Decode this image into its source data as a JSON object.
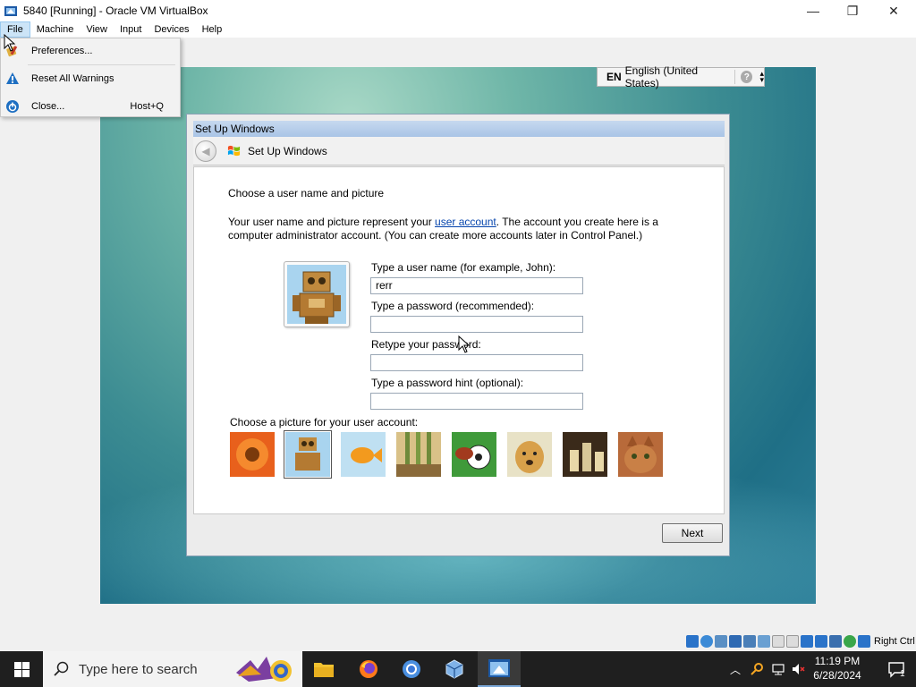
{
  "window": {
    "title": "5840 [Running] - Oracle VM VirtualBox",
    "controls": {
      "minimize": "—",
      "restore": "❐",
      "close": "✕"
    }
  },
  "menubar": {
    "items": [
      "File",
      "Machine",
      "View",
      "Input",
      "Devices",
      "Help"
    ],
    "active": "File"
  },
  "file_menu": {
    "items": [
      {
        "label": "Preferences...",
        "icon": "preferences-icon",
        "shortcut": ""
      },
      {
        "label": "Reset All Warnings",
        "icon": "warning-icon",
        "shortcut": ""
      },
      {
        "label": "Close...",
        "icon": "power-icon",
        "shortcut": "Host+Q"
      }
    ]
  },
  "langbar": {
    "code": "EN",
    "language": "English (United States)",
    "help": "?"
  },
  "setup": {
    "caption": "Set Up Windows",
    "header_title": "Set Up Windows",
    "heading": "Choose a user name and picture",
    "desc_part1": "Your user name and picture represent your ",
    "desc_link": "user account",
    "desc_part2": ". The account you create here is a computer administrator account. (You can create more accounts later in Control Panel.)",
    "fields": [
      {
        "label": "Type a user name (for example, John):",
        "value": "rerr"
      },
      {
        "label": "Type a password (recommended):",
        "value": ""
      },
      {
        "label": "Retype your password:",
        "value": ""
      },
      {
        "label": "Type a password hint (optional):",
        "value": ""
      }
    ],
    "picture_label": "Choose a picture for your user account:",
    "pictures": [
      "flower",
      "robot",
      "fish",
      "bamboo",
      "soccer",
      "dog",
      "chess",
      "cat"
    ],
    "selected_picture": "robot",
    "next_label": "Next"
  },
  "vb_status": {
    "host_key": "Right Ctrl"
  },
  "taskbar": {
    "search_placeholder": "Type here to search",
    "time": "11:19 PM",
    "date": "6/28/2024",
    "notification_count": "1"
  },
  "colors": {
    "link": "#0645ad",
    "taskbar": "#1f1f1f",
    "dialog_caption": "#b4cce9",
    "menu_active": "#cce4f7"
  }
}
